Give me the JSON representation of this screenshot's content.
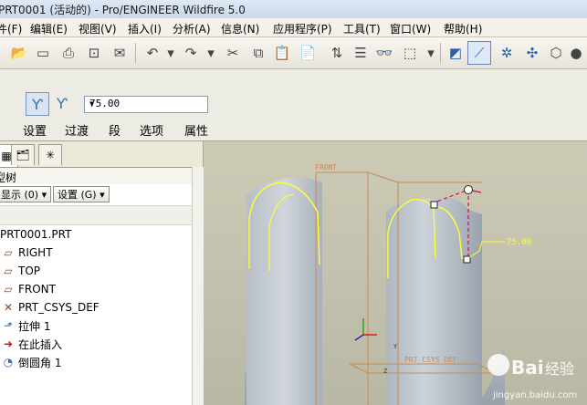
{
  "window": {
    "title": "PRT0001 (活动的) - Pro/ENGINEER Wildfire 5.0"
  },
  "menu": {
    "items": [
      "件(F)",
      "编辑(E)",
      "视图(V)",
      "插入(I)",
      "分析(A)",
      "信息(N)",
      "应用程序(P)",
      "工具(T)",
      "窗口(W)",
      "帮助(H)"
    ]
  },
  "toolbar": {
    "icons": [
      "open-icon",
      "save-icon",
      "print-icon",
      "send-icon",
      "mail-icon",
      "undo-icon",
      "redo-icon",
      "cut-icon",
      "copy-icon",
      "paste-icon",
      "paste-special-icon",
      "regenerate-icon",
      "find-icon",
      "select-box-icon",
      "datum-plane-icon",
      "datum-axis-icon",
      "datum-point-icon",
      "coordinate-system-icon",
      "view-icon",
      "shading-icon"
    ]
  },
  "dashboard": {
    "value": "75.00",
    "tabs": [
      "设置",
      "过渡",
      "段",
      "选项",
      "属性"
    ]
  },
  "panel": {
    "header": "型树",
    "display_button": "显示 (0)",
    "settings_button": "设置 (G)",
    "tree": [
      {
        "label": "PRT0001.PRT",
        "icon": "part-icon"
      },
      {
        "label": "RIGHT",
        "icon": "datum-plane-icon"
      },
      {
        "label": "TOP",
        "icon": "datum-plane-icon"
      },
      {
        "label": "FRONT",
        "icon": "datum-plane-icon"
      },
      {
        "label": "PRT_CSYS_DEF",
        "icon": "coordinate-system-icon"
      },
      {
        "label": "拉伸 1",
        "icon": "extrude-icon"
      },
      {
        "label": "在此插入",
        "icon": "insert-here-icon"
      },
      {
        "label": "倒圆角 1",
        "icon": "round-icon"
      }
    ]
  },
  "viewport": {
    "labels": {
      "front": "FRONT",
      "dimension": "75.00",
      "csys": "PRT_CSYS_DEF",
      "axis_y": "Y",
      "axis_z": "Z"
    },
    "colors": {
      "highlight": "#ffff33",
      "dimension": "#cc1144",
      "datum": "#c98a55"
    }
  },
  "watermark": {
    "brand": "Bai",
    "suffix": "经验",
    "url": "jingyan.baidu.com"
  }
}
